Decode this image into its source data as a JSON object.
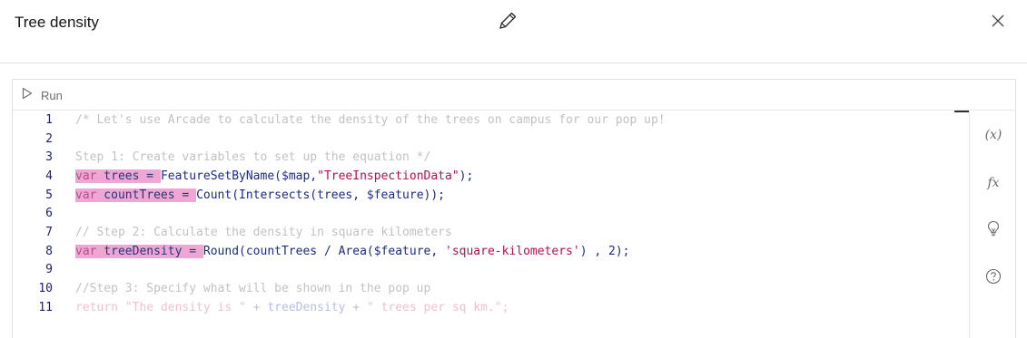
{
  "header": {
    "title": "Tree density"
  },
  "icons": {
    "edit": "pencil-icon",
    "close": "close-icon",
    "run": "play-icon",
    "variables": "variables-icon",
    "functions": "functions-icon",
    "suggestions": "lightbulb-icon",
    "help": "help-icon"
  },
  "toolbar": {
    "run_label": "Run"
  },
  "side_rail": {
    "variables_label": "(x)",
    "functions_label": "fx"
  },
  "editor": {
    "line_numbers": [
      "1",
      "2",
      "3",
      "4",
      "5",
      "6",
      "7",
      "8",
      "9",
      "10",
      "11"
    ],
    "line1": "/* Let's use Arcade to calculate the density of the trees on campus for our pop up!",
    "line3": "Step 1: Create variables to set up the equation */",
    "line4": {
      "kw": "var",
      "id": " trees = ",
      "fn": "FeatureSetByName($map,",
      "str": "\"TreeInspectionData\"",
      "end": ");"
    },
    "line5": {
      "kw": "var",
      "id": " countTrees = ",
      "fn": "Count(Intersects(trees, $feature));"
    },
    "line7": "// Step 2: Calculate the density in square kilometers",
    "line8": {
      "kw": "var",
      "id": " treeDensity = ",
      "fn": "Round(countTrees / Area($feature, ",
      "str": "'square-kilometers'",
      "end": ") , 2);"
    },
    "line10": "//Step 3: Specify what will be shown in the pop up",
    "line11": {
      "kw": "return",
      "str1": " \"The density is \"",
      "op1": " + ",
      "id": "treeDensity",
      "op2": " + ",
      "str2": "\" trees per sq km.\"",
      "end": ";"
    }
  },
  "colors": {
    "highlight": "#f0a6d4",
    "keyword": "#b54f8a",
    "string": "#b3124a",
    "function": "#1d2a86",
    "comment": "#c2c2c2"
  }
}
